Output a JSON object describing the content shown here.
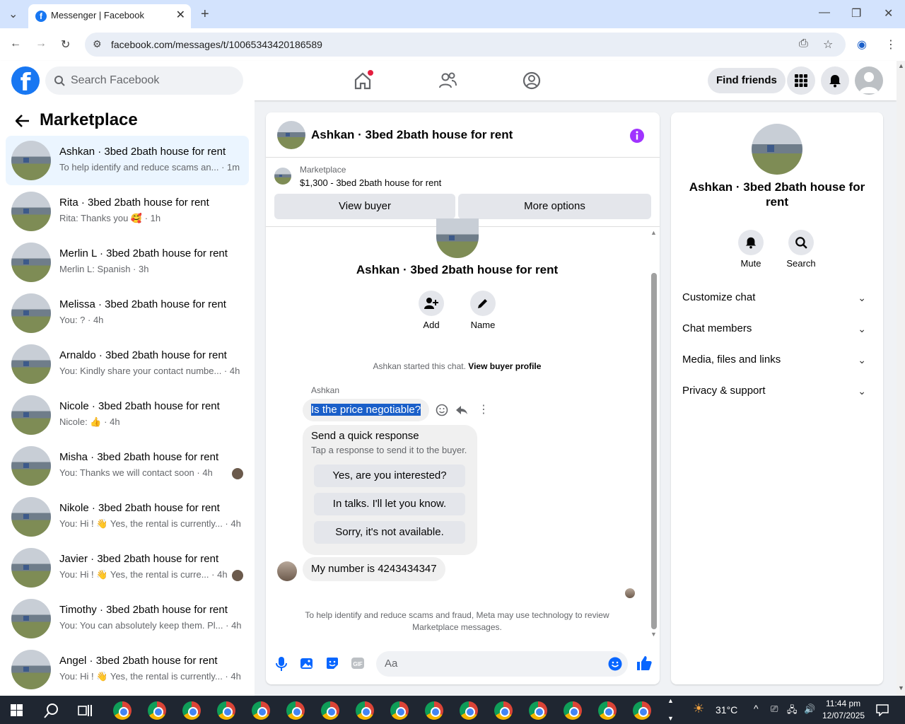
{
  "browser": {
    "tab_title": "Messenger | Facebook",
    "url": "facebook.com/messages/t/10065343420186589"
  },
  "header": {
    "search_placeholder": "Search Facebook",
    "find_friends": "Find friends"
  },
  "left": {
    "title": "Marketplace",
    "conversations": [
      {
        "name": "Ashkan · 3bed 2bath house for rent",
        "snippet": "To help identify and reduce scams an... · 1m"
      },
      {
        "name": "Rita · 3bed 2bath house for rent",
        "snippet": "Rita: Thanks you 🥰 · 1h"
      },
      {
        "name": "Merlin L · 3bed 2bath house for rent",
        "snippet": "Merlin L: Spanish · 3h"
      },
      {
        "name": "Melissa · 3bed 2bath house for rent",
        "snippet": "You: ? · 4h"
      },
      {
        "name": "Arnaldo · 3bed 2bath house for rent",
        "snippet": "You: Kindly share your contact numbe... · 4h"
      },
      {
        "name": "Nicole · 3bed 2bath house for rent",
        "snippet": "Nicole: 👍 · 4h"
      },
      {
        "name": "Misha · 3bed 2bath house for rent",
        "snippet": "You: Thanks we will contact soon · 4h"
      },
      {
        "name": "Nikole · 3bed 2bath house for rent",
        "snippet": "You: Hi ! 👋 Yes, the rental is currently... · 4h"
      },
      {
        "name": "Javier · 3bed 2bath house for rent",
        "snippet": "You: Hi ! 👋 Yes, the rental is curre... · 4h"
      },
      {
        "name": "Timothy · 3bed 2bath house for rent",
        "snippet": "You: You can absolutely keep them. Pl... · 4h"
      },
      {
        "name": "Angel · 3bed 2bath house for rent",
        "snippet": "You: Hi ! 👋 Yes, the rental is currently... · 4h"
      }
    ]
  },
  "chat": {
    "title": "Ashkan · 3bed 2bath house for rent",
    "listing_label": "Marketplace",
    "listing_title": "$1,300 - 3bed 2bath house for rent",
    "view_buyer": "View buyer",
    "more_options": "More options",
    "profile_name": "Ashkan · 3bed 2bath house for rent",
    "add_label": "Add",
    "name_label": "Name",
    "started_text": "Ashkan started this chat.",
    "view_buyer_profile": "View buyer profile",
    "sender": "Ashkan",
    "msg1": "Is the price negotiable?",
    "quick_title": "Send a quick response",
    "quick_sub": "Tap a response to send it to the buyer.",
    "quick_responses": [
      "Yes, are you interested?",
      "In talks. I'll let you know.",
      "Sorry, it's not available."
    ],
    "msg2": "My number is 4243434347",
    "notice": "To help identify and reduce scams and fraud, Meta may use technology to review Marketplace messages.",
    "input_placeholder": "Aa"
  },
  "right": {
    "name": "Ashkan · 3bed 2bath house for rent",
    "mute": "Mute",
    "search": "Search",
    "sections": [
      "Customize chat",
      "Chat members",
      "Media, files and links",
      "Privacy & support"
    ]
  },
  "taskbar": {
    "temperature": "31°C",
    "time": "11:44 pm",
    "date": "12/07/2025"
  },
  "colors": {
    "fb_blue": "#1877f2",
    "messenger_purple": "#a033ff"
  }
}
